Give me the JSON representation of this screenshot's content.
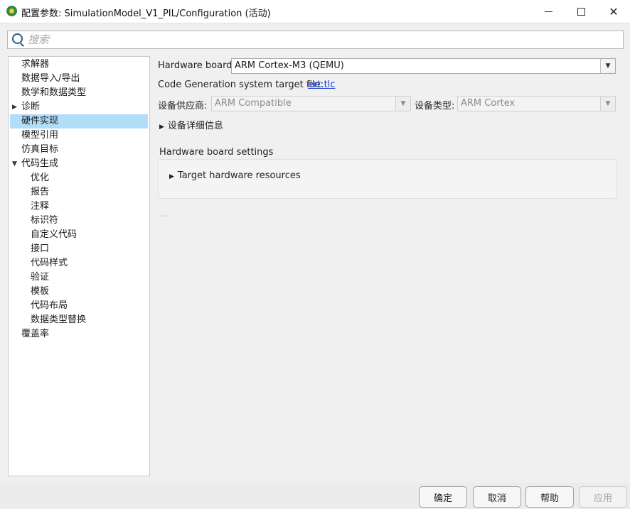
{
  "window": {
    "title": "配置参数: SimulationModel_V1_PIL/Configuration (活动)",
    "minimize": "—",
    "close": "✕"
  },
  "search": {
    "placeholder": "搜索"
  },
  "tree": {
    "items": [
      {
        "label": "求解器",
        "selected": false
      },
      {
        "label": "数据导入/导出",
        "selected": false
      },
      {
        "label": "数学和数据类型",
        "selected": false
      },
      {
        "label": "诊断",
        "selected": false,
        "expander": "▶"
      },
      {
        "label": "硬件实现",
        "selected": true
      },
      {
        "label": "模型引用",
        "selected": false
      },
      {
        "label": "仿真目标",
        "selected": false
      },
      {
        "label": "代码生成",
        "selected": false,
        "expander": "▼"
      },
      {
        "label": "优化",
        "selected": false
      },
      {
        "label": "报告",
        "selected": false
      },
      {
        "label": "注释",
        "selected": false
      },
      {
        "label": "标识符",
        "selected": false
      },
      {
        "label": "自定义代码",
        "selected": false
      },
      {
        "label": "接口",
        "selected": false
      },
      {
        "label": "代码样式",
        "selected": false
      },
      {
        "label": "验证",
        "selected": false
      },
      {
        "label": "模板",
        "selected": false
      },
      {
        "label": "代码布局",
        "selected": false
      },
      {
        "label": "数据类型替换",
        "selected": false
      },
      {
        "label": "覆盖率",
        "selected": false
      }
    ]
  },
  "main": {
    "hardware_board_label": "Hardware board:",
    "hardware_board_value": "ARM Cortex-M3 (QEMU)",
    "codegen_label": "Code Generation system target file:",
    "codegen_link": "ert.tlc",
    "vendor_label": "设备供应商:",
    "vendor_value": "ARM Compatible",
    "type_label": "设备类型:",
    "type_value": "ARM Cortex",
    "details_label": "设备详细信息",
    "expander_collapsed": "▶",
    "dropdown_arrow": "▼",
    "settings_heading": "Hardware board settings",
    "target_resources": "Target hardware resources",
    "ellipsis": "..."
  },
  "buttons": {
    "ok": "确定",
    "cancel": "取消",
    "help": "帮助",
    "apply": "应用"
  },
  "colors": {
    "selection": "#b1ddf9",
    "link": "#1a3ccf"
  }
}
